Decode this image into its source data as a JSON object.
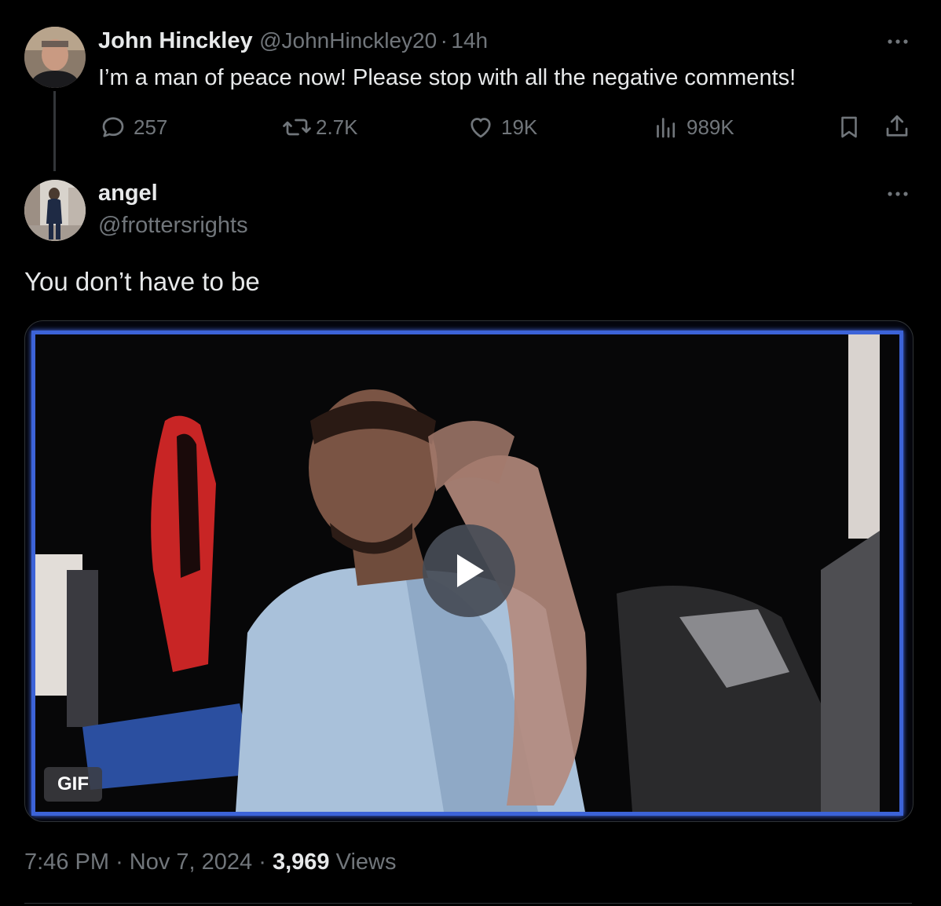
{
  "parent_tweet": {
    "display_name": "John Hinckley",
    "handle": "@JohnHinckley20",
    "separator": "·",
    "time": "14h",
    "text": "I’m a man of peace now! Please stop with all the negative comments!",
    "more_icon": "more-horizontal-icon",
    "actions": {
      "replies": "257",
      "reposts": "2.7K",
      "likes": "19K",
      "views": "989K"
    }
  },
  "reply_tweet": {
    "display_name": "angel",
    "handle": "@frottersrights",
    "more_icon": "more-horizontal-icon",
    "text": "You don’t have to be",
    "media": {
      "type_badge": "GIF",
      "frame_color": "#3c63d8"
    },
    "time": "7:46 PM",
    "date": "Nov 7, 2024",
    "separator": "·",
    "views_count": "3,969",
    "views_label": "Views"
  },
  "colors": {
    "background": "#000000",
    "primary_text": "#e7e9ea",
    "secondary_text": "#71767b",
    "divider": "#2f3336"
  }
}
